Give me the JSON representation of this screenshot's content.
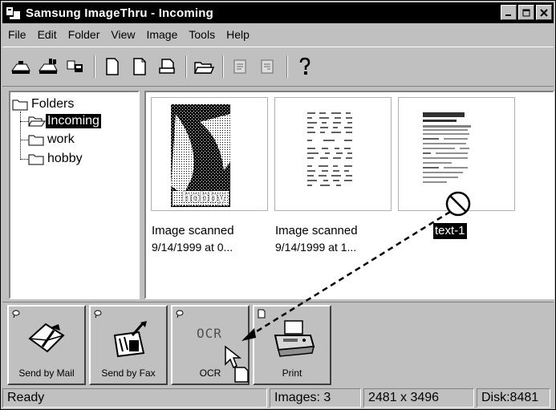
{
  "window": {
    "title": "Samsung ImageThru - Incoming",
    "buttons": {
      "minimize": "_",
      "maximize": "□",
      "close": "×"
    }
  },
  "menu": [
    {
      "label": "File"
    },
    {
      "label": "Edit"
    },
    {
      "label": "Folder"
    },
    {
      "label": "View"
    },
    {
      "label": "Image"
    },
    {
      "label": "Tools"
    },
    {
      "label": "Help"
    }
  ],
  "toolbar": {
    "icons": [
      "scanner-icon",
      "scanner-multi-icon",
      "acquire-icon",
      "new-page-icon",
      "copy-page-icon",
      "print-doc-icon",
      "open-folder-icon",
      "prev-page-icon",
      "next-page-icon",
      "help-icon"
    ]
  },
  "tree": {
    "root": "Folders",
    "items": [
      {
        "label": "Incoming",
        "selected": true
      },
      {
        "label": "work",
        "selected": false
      },
      {
        "label": "hobby",
        "selected": false
      }
    ]
  },
  "thumbnails": [
    {
      "caption_line1": "Image scanned",
      "caption_line2": "9/14/1999 at 0...",
      "overlay": "hobby"
    },
    {
      "caption_line1": "Image scanned",
      "caption_line2": "9/14/1999 at 1...",
      "overlay": ""
    },
    {
      "caption_line1": "text-1",
      "caption_line2": "",
      "overlay": ""
    }
  ],
  "shortcuts": [
    {
      "label": "Send by Mail"
    },
    {
      "label": "Send by Fax"
    },
    {
      "label": "OCR",
      "inner": "OCR"
    },
    {
      "label": "Print"
    }
  ],
  "status": {
    "text": "Ready",
    "images": "Images: 3",
    "dimensions": "2481 x 3496",
    "disk": "Disk:8481"
  }
}
